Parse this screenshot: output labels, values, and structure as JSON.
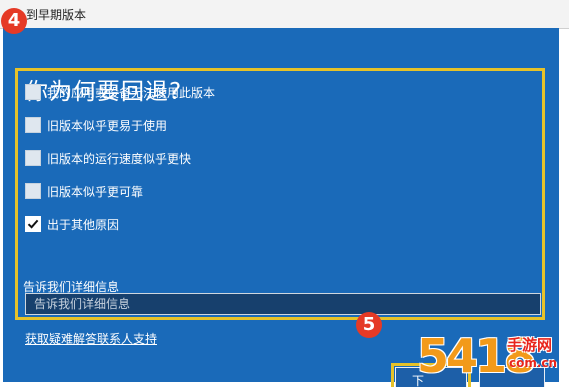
{
  "window": {
    "title": "到早期版本"
  },
  "callouts": {
    "step4": "4",
    "step5": "5"
  },
  "dialog": {
    "heading": "你为何要回退?",
    "options": [
      {
        "label": "我的应用或设备无法使用此版本",
        "checked": false
      },
      {
        "label": "旧版本似乎更易于使用",
        "checked": false
      },
      {
        "label": "旧版本的运行速度似乎更快",
        "checked": false
      },
      {
        "label": "旧版本似乎更可靠",
        "checked": false
      },
      {
        "label": "出于其他原因",
        "checked": true
      }
    ],
    "details_label": "告诉我们详细信息",
    "details_placeholder": "告诉我们详细信息",
    "help_link": "获取疑难解答联系人支持",
    "next_button": "下"
  },
  "watermark": {
    "number": "5418",
    "site_name": "手游网",
    "domain": "com.cn"
  },
  "colors": {
    "background": "#1a6ab9",
    "highlight": "#e6c229",
    "callout": "#e53a26"
  }
}
